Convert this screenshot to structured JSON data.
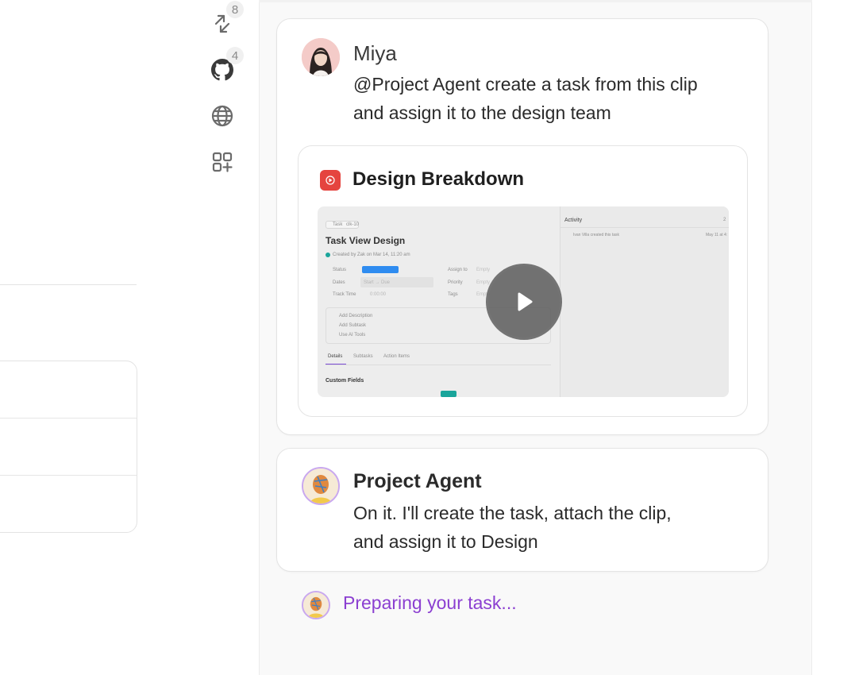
{
  "rail": {
    "badges": {
      "sync": "8",
      "github": "4"
    }
  },
  "messages": [
    {
      "author": "Miya",
      "text_line1": "@Project Agent create a task from this clip",
      "text_line2": "and assign it to the design team"
    },
    {
      "author": "Project Agent",
      "text_line1": "On it. I'll create the task, attach the clip,",
      "text_line2": "and assign it to Design"
    }
  ],
  "clip": {
    "title": "Design Breakdown",
    "preview": {
      "task_chip": "Task",
      "task_id": "clk-10",
      "title": "Task View Design",
      "created": "Created by Zak on Mar 14, 11:20 am",
      "fields": {
        "status_label": "Status",
        "dates_label": "Dates",
        "dates_value": "Start → Due",
        "track_label": "Track Time",
        "track_value": "0:00:00",
        "assign_label": "Assign to",
        "assign_value": "Empty",
        "priority_label": "Priority",
        "priority_value": "Empty",
        "tags_label": "Tags",
        "tags_value": "Empty"
      },
      "actions": [
        "Add Description",
        "Add Subtask",
        "Use AI Tools"
      ],
      "tabs": [
        "Details",
        "Subtasks",
        "Action Items"
      ],
      "section": "Custom Fields",
      "activity_title": "Activity",
      "activity_count": "2",
      "activity_entry": "Ivan Villa created this task",
      "activity_time": "May 11 at 4:"
    }
  },
  "status": {
    "preparing": "Preparing your task..."
  },
  "colors": {
    "accent_purple": "#8b3fd1",
    "play_red": "#e5443f",
    "status_blue": "#2f8cf0",
    "teal": "#1aa59b"
  }
}
